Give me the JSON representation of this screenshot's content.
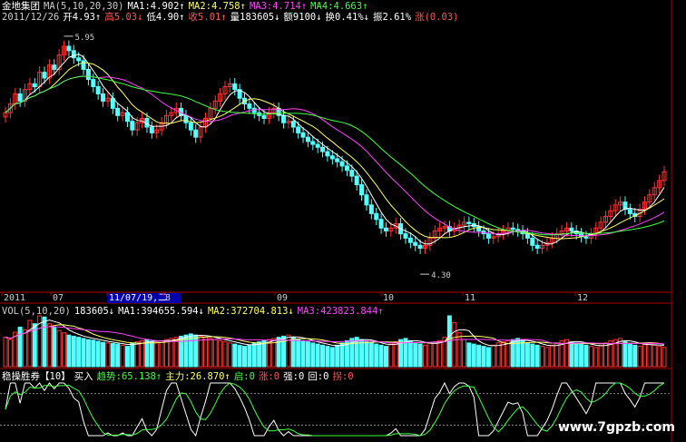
{
  "header": {
    "row1": [
      {
        "text": "金地集团",
        "color": "#ffffff"
      },
      {
        "text": "MA(5,10,20,30)",
        "color": "#cccccc"
      },
      {
        "text": "MA1:4.902↑",
        "color": "#ffffff"
      },
      {
        "text": "MA2:4.758↑",
        "color": "#ffff66"
      },
      {
        "text": "MA3:4.714↑",
        "color": "#ff44ff"
      },
      {
        "text": "MA4:4.663↑",
        "color": "#44ff44"
      }
    ],
    "row2": [
      {
        "text": "2011/12/26",
        "color": "#cccccc"
      },
      {
        "text": "开4.93↑",
        "color": "#ffffff"
      },
      {
        "text": "高5.03↓",
        "color": "#ff5555"
      },
      {
        "text": "低4.90↑",
        "color": "#ffffff"
      },
      {
        "text": "收5.01↑",
        "color": "#ff5555"
      },
      {
        "text": "量183605↓",
        "color": "#ffffff"
      },
      {
        "text": "额9100↓",
        "color": "#ffffff"
      },
      {
        "text": "换0.41%↓",
        "color": "#ffffff"
      },
      {
        "text": "振2.61%",
        "color": "#ffffff"
      },
      {
        "text": "涨(0.03)",
        "color": "#ff5555"
      }
    ],
    "vol_row": [
      {
        "text": "VOL(5,10,20)",
        "color": "#cccccc"
      },
      {
        "text": "183605↓",
        "color": "#ffffff"
      },
      {
        "text": "MA1:394655.594↓",
        "color": "#ffffff"
      },
      {
        "text": "MA2:372704.813↓",
        "color": "#ffff66"
      },
      {
        "text": "MA3:423823.844↑",
        "color": "#ff44ff"
      }
    ],
    "ind_row": [
      {
        "text": "稳操胜券【10】",
        "color": "#ffffff"
      },
      {
        "text": "买入",
        "color": "#ffffff"
      },
      {
        "text": "趋势:65.138↑",
        "color": "#44ff44"
      },
      {
        "text": "主力:26.870↑",
        "color": "#ffff66"
      },
      {
        "text": "启:0",
        "color": "#44ff44"
      },
      {
        "text": "涨:0",
        "color": "#ff5555"
      },
      {
        "text": "强:0",
        "color": "#ffffff"
      },
      {
        "text": "回:0",
        "color": "#ffffff"
      },
      {
        "text": "拐:0",
        "color": "#ff5555"
      }
    ]
  },
  "watermark": "www.7gpzb.com",
  "colors": {
    "up": "#ff3333",
    "down": "#54ffff",
    "ma1": "#ffffff",
    "ma2": "#ffff66",
    "ma3": "#ff44ff",
    "ma4": "#44ff44",
    "axis": "#b00000"
  },
  "chart_data": {
    "type": "candlestick",
    "symbol": "金地集团",
    "date_labels": [
      "2011",
      "07",
      "11/07/19,二",
      "8",
      "09",
      "10",
      "11",
      "12"
    ],
    "price_annotations": [
      {
        "label": "5.95",
        "value": 5.95
      },
      {
        "label": "4.30",
        "value": 4.3
      }
    ],
    "ylim": [
      4.2,
      6.05
    ],
    "last_bar": {
      "date": "2011/12/26",
      "open": 4.93,
      "high": 5.03,
      "low": 4.9,
      "close": 5.01,
      "volume": 183605
    },
    "ma_last": {
      "MA1": 4.902,
      "MA2": 4.758,
      "MA3": 4.714,
      "MA4": 4.663
    },
    "vol_ma_last": {
      "MA1": 394655.594,
      "MA2": 372704.813,
      "MA3": 423823.844
    },
    "indicator": {
      "name": "稳操胜券",
      "period": 10,
      "signal": "买入",
      "趋势": 65.138,
      "主力": 26.87,
      "启": 0,
      "涨": 0,
      "强": 0,
      "回": 0,
      "拐": 0
    },
    "closes": [
      5.42,
      5.48,
      5.55,
      5.5,
      5.58,
      5.62,
      5.6,
      5.7,
      5.66,
      5.75,
      5.72,
      5.82,
      5.88,
      5.85,
      5.8,
      5.78,
      5.72,
      5.65,
      5.6,
      5.55,
      5.5,
      5.52,
      5.45,
      5.4,
      5.42,
      5.36,
      5.3,
      5.35,
      5.38,
      5.32,
      5.28,
      5.3,
      5.35,
      5.4,
      5.42,
      5.45,
      5.4,
      5.35,
      5.3,
      5.25,
      5.32,
      5.38,
      5.45,
      5.5,
      5.55,
      5.6,
      5.62,
      5.58,
      5.52,
      5.48,
      5.45,
      5.42,
      5.4,
      5.38,
      5.42,
      5.45,
      5.4,
      5.35,
      5.36,
      5.32,
      5.28,
      5.25,
      5.22,
      5.2,
      5.18,
      5.15,
      5.12,
      5.1,
      5.08,
      5.05,
      5.02,
      4.98,
      4.92,
      4.85,
      4.78,
      4.72,
      4.68,
      4.62,
      4.6,
      4.62,
      4.65,
      4.58,
      4.55,
      4.52,
      4.5,
      4.48,
      4.5,
      4.55,
      4.6,
      4.62,
      4.63,
      4.6,
      4.62,
      4.64,
      4.66,
      4.65,
      4.63,
      4.6,
      4.58,
      4.55,
      4.56,
      4.58,
      4.6,
      4.62,
      4.61,
      4.6,
      4.58,
      4.55,
      4.5,
      4.48,
      4.5,
      4.52,
      4.55,
      4.58,
      4.6,
      4.62,
      4.6,
      4.58,
      4.56,
      4.55,
      4.58,
      4.62,
      4.66,
      4.7,
      4.74,
      4.78,
      4.8,
      4.75,
      4.72,
      4.7,
      4.75,
      4.8,
      4.85,
      4.9,
      4.95,
      5.01
    ],
    "volumes": [
      520,
      480,
      610,
      700,
      650,
      820,
      760,
      900,
      880,
      760,
      700,
      640,
      600,
      560,
      540,
      520,
      500,
      480,
      470,
      450,
      430,
      420,
      410,
      400,
      380,
      360,
      420,
      440,
      460,
      480,
      450,
      430,
      460,
      480,
      500,
      520,
      540,
      560,
      580,
      560,
      540,
      520,
      500,
      480,
      460,
      440,
      420,
      400,
      380,
      360,
      380,
      420,
      440,
      460,
      480,
      500,
      520,
      540,
      560,
      520,
      480,
      460,
      440,
      420,
      400,
      380,
      360,
      340,
      380,
      420,
      460,
      500,
      520,
      480,
      440,
      420,
      400,
      380,
      360,
      400,
      440,
      480,
      500,
      460,
      420,
      400,
      380,
      420,
      440,
      460,
      520,
      900,
      780,
      600,
      480,
      420,
      400,
      380,
      360,
      340,
      380,
      420,
      440,
      460,
      480,
      500,
      460,
      420,
      400,
      380,
      360,
      340,
      380,
      420,
      460,
      480,
      440,
      420,
      400,
      380,
      360,
      340,
      380,
      420,
      460,
      480,
      500,
      440,
      400,
      380,
      360,
      400,
      420,
      380,
      360,
      340
    ]
  }
}
